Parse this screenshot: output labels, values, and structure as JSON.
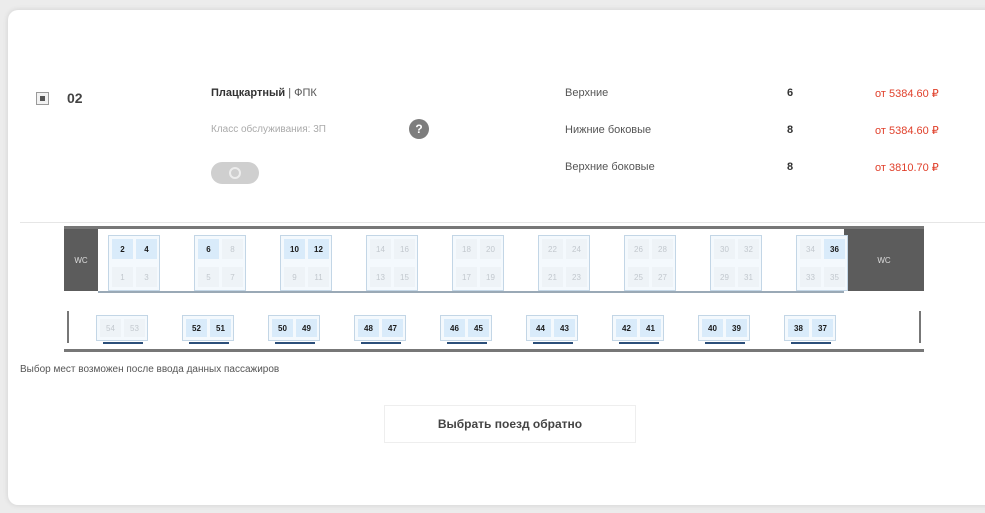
{
  "car": {
    "number": "02",
    "type": "Плацкартный",
    "carrier": "ФПК",
    "separator": " | ",
    "service_class": "Класс обслуживания: 3П",
    "help_glyph": "?"
  },
  "tariffs": [
    {
      "label": "Верхние",
      "count": "6",
      "price": "от 5384.60 ₽"
    },
    {
      "label": "Нижние боковые",
      "count": "8",
      "price": "от 5384.60 ₽"
    },
    {
      "label": "Верхние боковые",
      "count": "8",
      "price": "от 3810.70 ₽"
    }
  ],
  "scheme": {
    "vestibule_label": "WC",
    "compartments": [
      [
        {
          "n": "2",
          "free": true
        },
        {
          "n": "4",
          "free": true
        },
        {
          "n": "1",
          "free": false
        },
        {
          "n": "3",
          "free": false
        }
      ],
      [
        {
          "n": "6",
          "free": true
        },
        {
          "n": "8",
          "free": false
        },
        {
          "n": "5",
          "free": false
        },
        {
          "n": "7",
          "free": false
        }
      ],
      [
        {
          "n": "10",
          "free": true
        },
        {
          "n": "12",
          "free": true
        },
        {
          "n": "9",
          "free": false
        },
        {
          "n": "11",
          "free": false
        }
      ],
      [
        {
          "n": "14",
          "free": false
        },
        {
          "n": "16",
          "free": false
        },
        {
          "n": "13",
          "free": false
        },
        {
          "n": "15",
          "free": false
        }
      ],
      [
        {
          "n": "18",
          "free": false
        },
        {
          "n": "20",
          "free": false
        },
        {
          "n": "17",
          "free": false
        },
        {
          "n": "19",
          "free": false
        }
      ],
      [
        {
          "n": "22",
          "free": false
        },
        {
          "n": "24",
          "free": false
        },
        {
          "n": "21",
          "free": false
        },
        {
          "n": "23",
          "free": false
        }
      ],
      [
        {
          "n": "26",
          "free": false
        },
        {
          "n": "28",
          "free": false
        },
        {
          "n": "25",
          "free": false
        },
        {
          "n": "27",
          "free": false
        }
      ],
      [
        {
          "n": "30",
          "free": false
        },
        {
          "n": "32",
          "free": false
        },
        {
          "n": "29",
          "free": false
        },
        {
          "n": "31",
          "free": false
        }
      ],
      [
        {
          "n": "34",
          "free": false
        },
        {
          "n": "36",
          "free": true
        },
        {
          "n": "33",
          "free": false
        },
        {
          "n": "35",
          "free": false
        }
      ]
    ],
    "side_seats": [
      [
        {
          "n": "54",
          "free": false
        },
        {
          "n": "53",
          "free": false
        }
      ],
      [
        {
          "n": "52",
          "free": true
        },
        {
          "n": "51",
          "free": true
        }
      ],
      [
        {
          "n": "50",
          "free": true
        },
        {
          "n": "49",
          "free": true
        }
      ],
      [
        {
          "n": "48",
          "free": true
        },
        {
          "n": "47",
          "free": true
        }
      ],
      [
        {
          "n": "46",
          "free": true
        },
        {
          "n": "45",
          "free": true
        }
      ],
      [
        {
          "n": "44",
          "free": true
        },
        {
          "n": "43",
          "free": true
        }
      ],
      [
        {
          "n": "42",
          "free": true
        },
        {
          "n": "41",
          "free": true
        }
      ],
      [
        {
          "n": "40",
          "free": true
        },
        {
          "n": "39",
          "free": true
        }
      ],
      [
        {
          "n": "38",
          "free": true
        },
        {
          "n": "37",
          "free": true
        }
      ]
    ]
  },
  "note": "Выбор мест возможен после ввода данных пассажиров",
  "back_button_label": "Выбрать поезд обратно",
  "colors": {
    "price": "#e0402b",
    "seat_free": "#d9ebfa",
    "seat_occupied": "#eef3f7",
    "vestibule": "#5c5c5c"
  }
}
